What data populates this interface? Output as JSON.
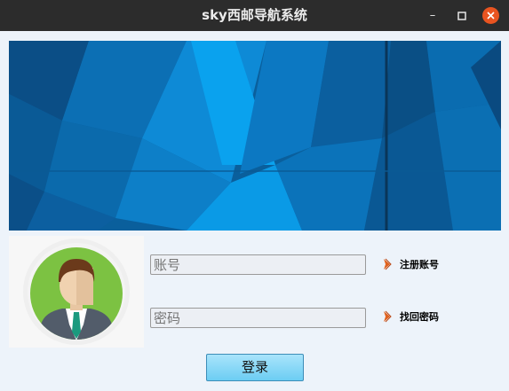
{
  "window": {
    "title": "sky西邮导航系统",
    "minimize_icon": "minimize-icon",
    "maximize_icon": "maximize-icon",
    "close_icon": "close-icon",
    "close_color": "#e95420"
  },
  "banner": {
    "image": "blue-polygon-banner",
    "accent": "#0a7fd0"
  },
  "avatar": {
    "image": "user-avatar-businessman",
    "ring_color": "#7cc242"
  },
  "form": {
    "account_placeholder": "账号",
    "password_placeholder": "密码",
    "register_label": "注册账号",
    "recover_label": "找回密码",
    "link_icon": "chevron-right-icon",
    "login_label": "登录"
  }
}
